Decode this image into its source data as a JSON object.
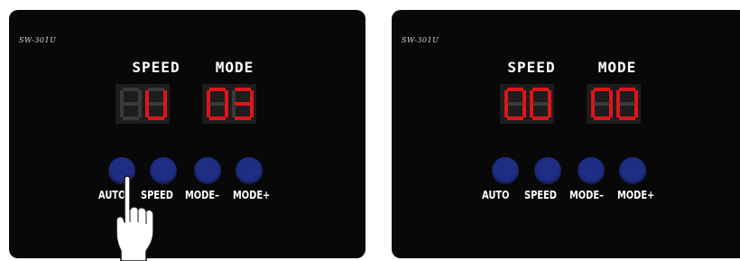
{
  "panels": [
    {
      "model": "SW-301U",
      "speed_label": "SPEED",
      "mode_label": "MODE",
      "speed_value": "U",
      "mode_value": "03",
      "buttons": [
        {
          "label": "AUTO",
          "color": "#1f2e84",
          "pressed": true
        },
        {
          "label": "SPEED",
          "color": "#1f2e84",
          "pressed": false
        },
        {
          "label": "MODE–",
          "color": "#1f2e84",
          "pressed": false
        },
        {
          "label": "MODE+",
          "color": "#1f2e84",
          "pressed": false
        }
      ]
    },
    {
      "model": "SW-301U",
      "speed_label": "SPEED",
      "mode_label": "MODE",
      "speed_value": "00",
      "mode_value": "00",
      "buttons": [
        {
          "label": "AUTO",
          "color": "#1f2e84",
          "pressed": false
        },
        {
          "label": "SPEED",
          "color": "#1f2e84",
          "pressed": false
        },
        {
          "label": "MODE–",
          "color": "#1f2e84",
          "pressed": false
        },
        {
          "label": "MODE+",
          "color": "#1f2e84",
          "pressed": false
        }
      ]
    }
  ],
  "colors": {
    "panel_background": "#080808",
    "display_background": "#1d1d1d",
    "segment_on": "#e0141b",
    "segment_off": "#3a3a3a",
    "button": "#1f2e84",
    "label_text": "#ffffff"
  },
  "icons": {
    "pointer": "pointing-hand-icon"
  }
}
